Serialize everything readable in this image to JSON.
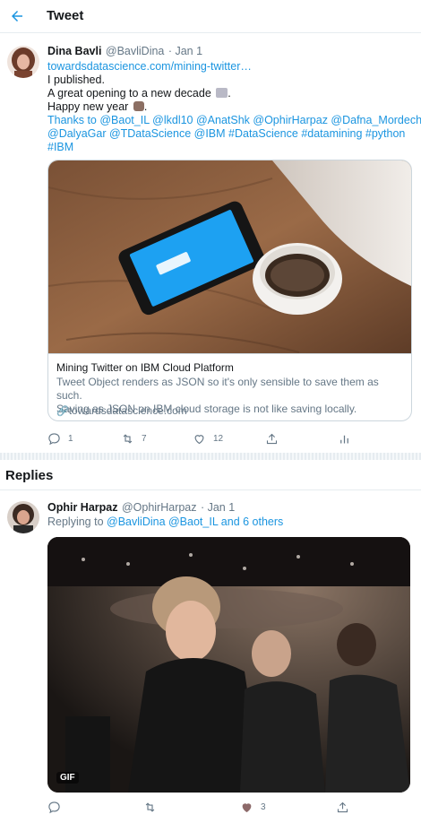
{
  "header": {
    "title": "Tweet"
  },
  "tweet": {
    "name": "Dina Bavli",
    "handle": "@BavliDina",
    "date": "· Jan 1",
    "lines": [
      "towardsdatascience.com/mining-twitter…",
      "I published.",
      "A great opening to a new decade",
      "Happy new year",
      "Thanks to @Baot_IL @lkdl10 @AnatShk @OphirHarpaz @Dafna_Mordechai",
      "@DalyaGar @TDataScience @IBM #DataScience #datamining  #python",
      "#IBM"
    ],
    "card": {
      "title": "Mining Twitter on IBM Cloud Platform",
      "desc_1": "Tweet Object renders as JSON so it's only sensible to save them as such.",
      "desc_2": "Saving as JSON on IBM cloud storage is not like saving locally.",
      "domain": "towardsdatascience.com"
    },
    "actions": {
      "replies": "1",
      "retweets": "7",
      "likes": "12"
    }
  },
  "section": {
    "replies_title": "Replies"
  },
  "reply": {
    "name": "Ophir Harpaz",
    "handle": "@OphirHarpaz",
    "date": "· Jan 1",
    "replying_prefix": "Replying to",
    "replying_to": "@BavliDina @Baot_IL and 6 others",
    "gif_label": "GIF",
    "actions": {
      "likes": "3"
    }
  },
  "colors": {
    "accent": "#1b95e0",
    "muted": "#657786"
  }
}
